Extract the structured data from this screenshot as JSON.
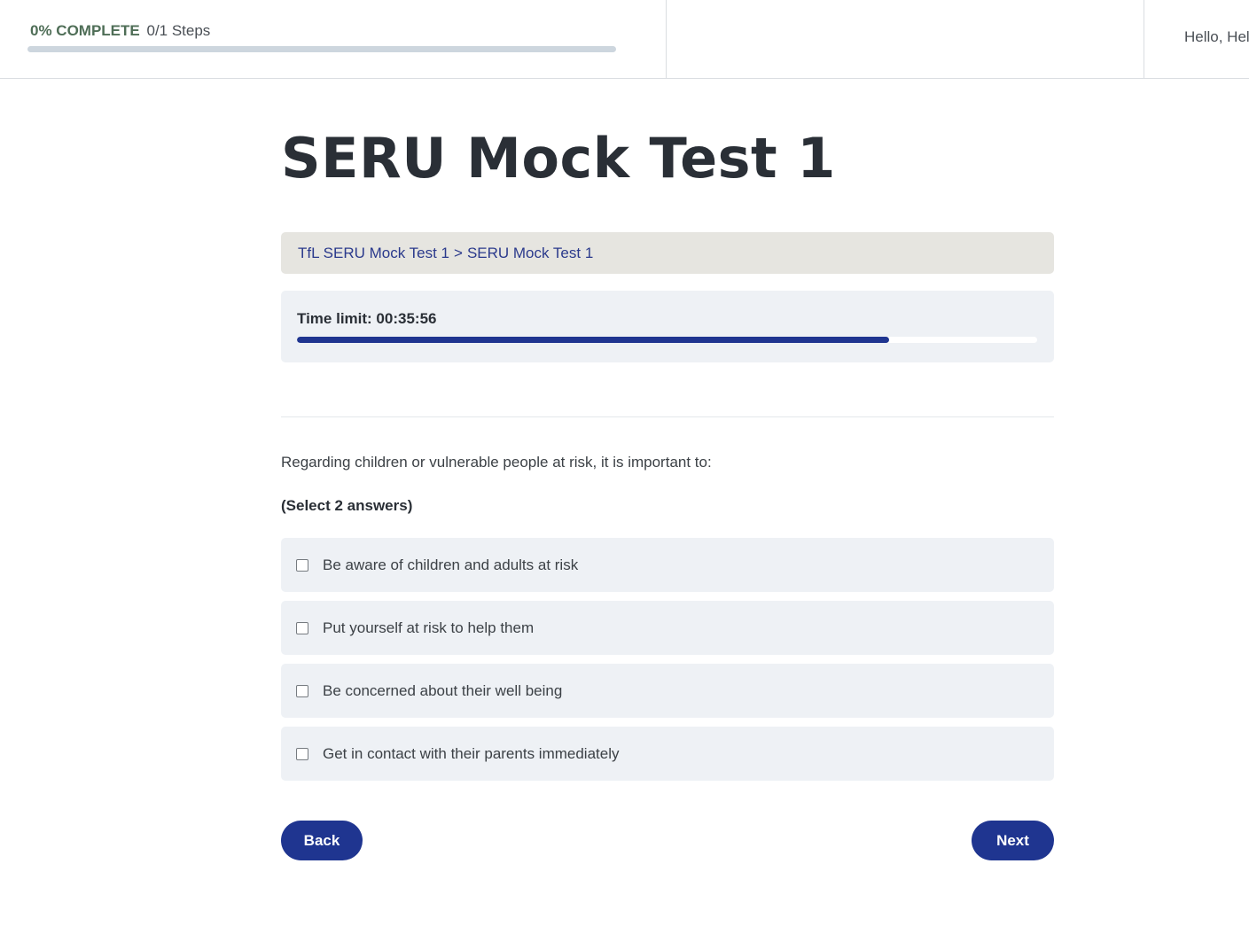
{
  "header": {
    "progress": {
      "percent_label": "0% COMPLETE",
      "steps_label": "0/1 Steps",
      "percent": 0
    },
    "greeting": "Hello, Hel"
  },
  "page": {
    "title": "SERU Mock Test 1"
  },
  "breadcrumb": {
    "course": "TfL SERU Mock Test 1",
    "separator": ">",
    "lesson": "SERU Mock Test 1"
  },
  "timer": {
    "label": "Time limit: 00:35:56",
    "remaining_fraction": 0.8
  },
  "quiz": {
    "question": "Regarding children or vulnerable people at risk, it is important to:",
    "instruction": "(Select 2 answers)",
    "answers": [
      {
        "label": "Be aware of children and adults at risk",
        "checked": false
      },
      {
        "label": "Put yourself at risk to help them",
        "checked": false
      },
      {
        "label": "Be concerned about their well being",
        "checked": false
      },
      {
        "label": "Get in contact with their parents immediately",
        "checked": false
      }
    ]
  },
  "buttons": {
    "back_label": "Back",
    "next_label": "Next"
  },
  "colors": {
    "accent": "#1f3590",
    "progress_green": "#4f6e57",
    "breadcrumb_bg": "#e6e5e0",
    "panel_bg": "#eef1f5"
  }
}
